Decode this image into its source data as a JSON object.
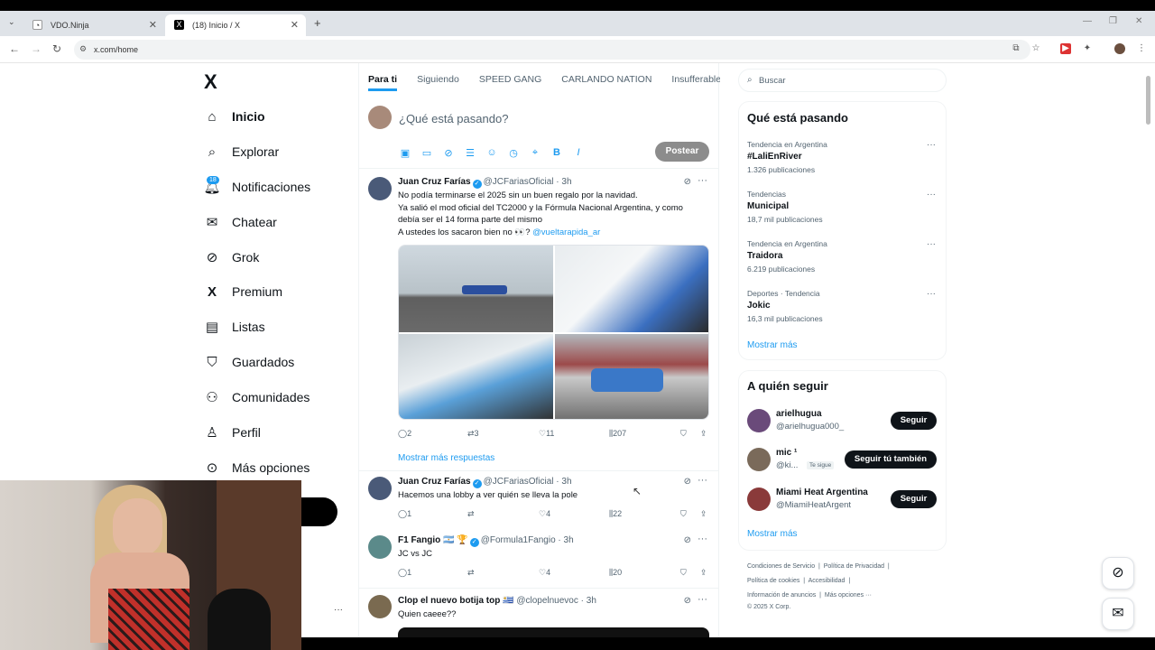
{
  "browser": {
    "tabs": [
      {
        "title": "VDO.Ninja",
        "active": false
      },
      {
        "title": "(18) Inicio / X",
        "active": true
      }
    ],
    "url": "x.com/home"
  },
  "nav": {
    "logo": "X",
    "notif_badge": "18",
    "items": [
      {
        "label": "Inicio",
        "icon": "home-icon"
      },
      {
        "label": "Explorar",
        "icon": "search-icon"
      },
      {
        "label": "Notificaciones",
        "icon": "bell-icon"
      },
      {
        "label": "Chatear",
        "icon": "mail-icon"
      },
      {
        "label": "Grok",
        "icon": "grok-icon"
      },
      {
        "label": "Premium",
        "icon": "x-premium-icon"
      },
      {
        "label": "Listas",
        "icon": "list-icon"
      },
      {
        "label": "Guardados",
        "icon": "bookmark-icon"
      },
      {
        "label": "Comunidades",
        "icon": "communities-icon"
      },
      {
        "label": "Perfil",
        "icon": "person-icon"
      },
      {
        "label": "Más opciones",
        "icon": "more-circle-icon"
      }
    ]
  },
  "timeline": {
    "tabs": [
      "Para ti",
      "Siguiendo",
      "SPEED GANG",
      "CARLANDO NATION",
      "Insufferable W"
    ],
    "compose_placeholder": "¿Qué está pasando?",
    "post_label": "Postear",
    "show_more_replies": "Mostrar más respuestas",
    "tweets": [
      {
        "name": "Juan Cruz Farías",
        "handle": "@JCFariasOficial · 3h",
        "lines": [
          "No podía terminarse el 2025 sin un buen regalo por la navidad.",
          "Ya salió el mod oficial del TC2000 y la Fórmula Nacional Argentina, y como",
          "debía ser el 14 forma parte del mismo"
        ],
        "last_line": "A ustedes los sacaron bien no 👀?",
        "link": "@vueltarapida_ar",
        "replies": "2",
        "reposts": "3",
        "likes": "11",
        "views": "207"
      },
      {
        "name": "Juan Cruz Farías",
        "handle": "@JCFariasOficial · 3h",
        "text": "Hacemos una lobby a ver quién se lleva la pole",
        "replies": "1",
        "reposts": "",
        "likes": "4",
        "views": "22"
      },
      {
        "name": "F1 Fangio 🇦🇷 🏆",
        "handle": "@Formula1Fangio · 3h",
        "text": "JC vs JC",
        "replies": "1",
        "reposts": "",
        "likes": "4",
        "views": "20"
      },
      {
        "name": "Clop el nuevo botija top 🇺🇾",
        "handle": "@clopelnuevoc · 3h",
        "text": "Quien caeee??"
      }
    ]
  },
  "sidebar": {
    "search_placeholder": "Buscar",
    "trends_title": "Qué está pasando",
    "trends": [
      {
        "meta": "Tendencia en Argentina",
        "name": "#LaliEnRiver",
        "count": "1.326 publicaciones"
      },
      {
        "meta": "Tendencias",
        "name": "Municipal",
        "count": "18,7 mil publicaciones"
      },
      {
        "meta": "Tendencia en Argentina",
        "name": "Traidora",
        "count": "6.219 publicaciones"
      },
      {
        "meta": "Deportes · Tendencia",
        "name": "Jokic",
        "count": "16,3 mil publicaciones"
      }
    ],
    "show_more": "Mostrar más",
    "follow_title": "A quién seguir",
    "follow": [
      {
        "name": "arielhugua",
        "handle": "@arielhugua000_",
        "button": "Seguir"
      },
      {
        "name": "mic ¹",
        "handle": "@ki...",
        "button": "Seguir tú también",
        "tag": "Te sigue"
      },
      {
        "name": "Miami Heat Argentina",
        "handle": "@MiamiHeatArgent",
        "button": "Seguir"
      }
    ],
    "follow_more": "Mostrar más",
    "footer": {
      "line1": [
        "Condiciones de Servicio",
        "Política de Privacidad"
      ],
      "line2": [
        "Política de cookies",
        "Accesibilidad"
      ],
      "line3": [
        "Información de anuncios",
        "Más opciones ···"
      ],
      "copyright": "© 2025 X Corp."
    }
  },
  "colors": {
    "accent": "#1d9bf0",
    "text": "#0f1419",
    "muted": "#536471",
    "button_dark": "#0f1419"
  }
}
